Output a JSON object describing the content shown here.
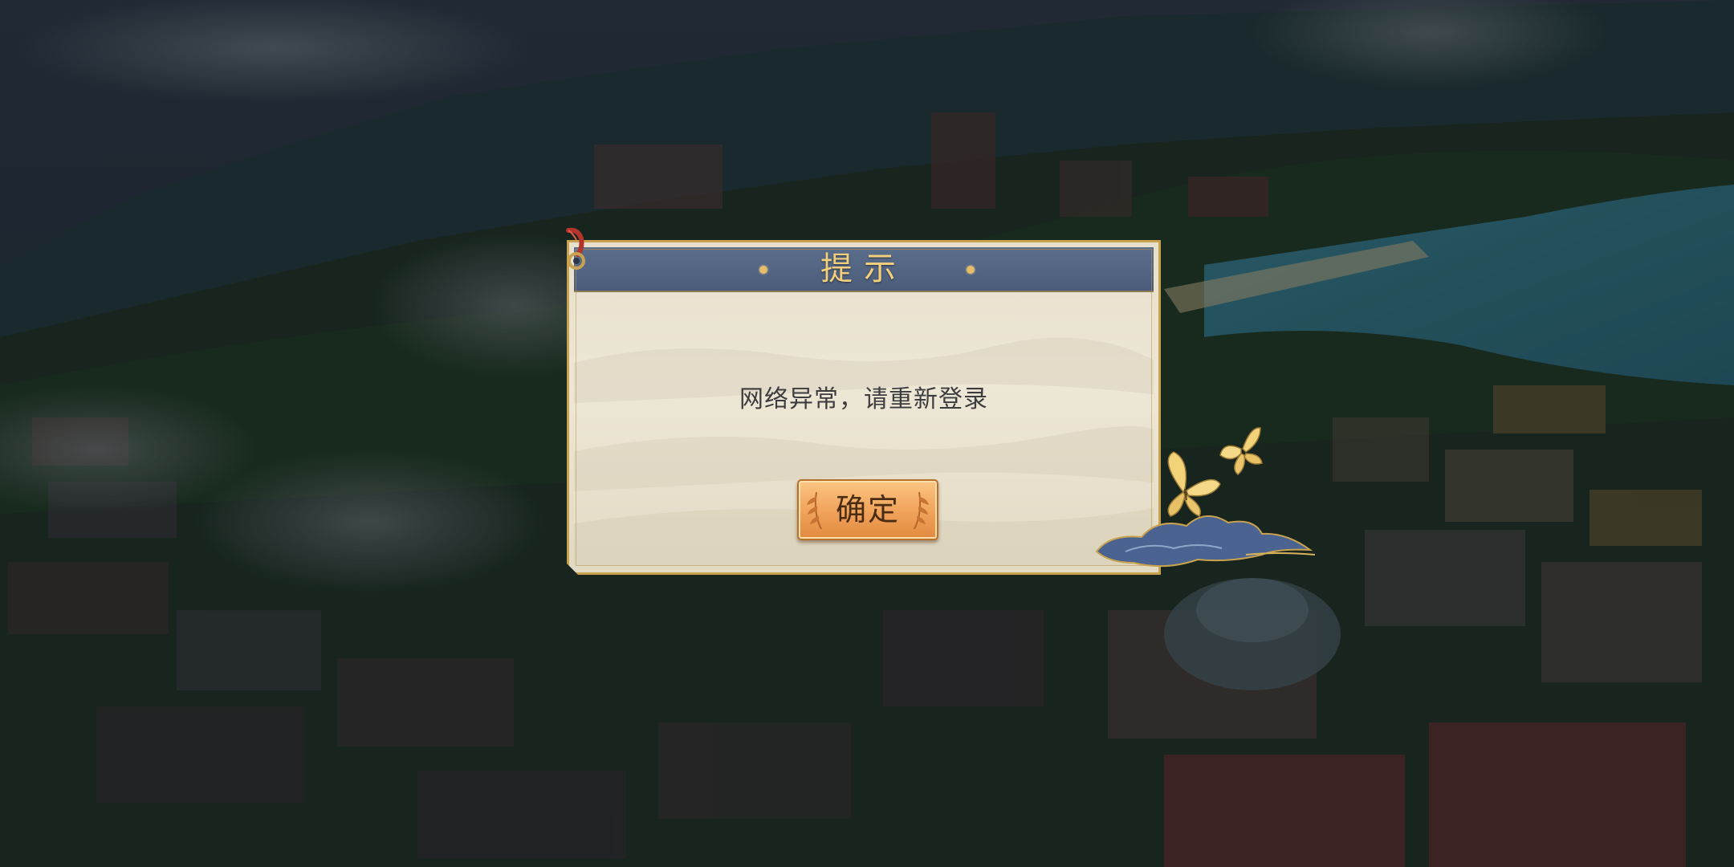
{
  "dialog": {
    "title": "提示",
    "message": "网络异常，请重新登录",
    "confirm_label": "确定"
  },
  "colors": {
    "title_bar": "#4a5c79",
    "title_text": "#f1cf7c",
    "frame_gold": "#c9a24f",
    "panel_paper": "#ede7d6",
    "button_orange": "#f0a25a",
    "message_text": "#3d3c3e"
  },
  "icons": {
    "corner_knot": "red-cord-knot-icon",
    "button_ornament": "wheat-ornament-icon",
    "decoration": "butterfly-cloud-decoration"
  }
}
